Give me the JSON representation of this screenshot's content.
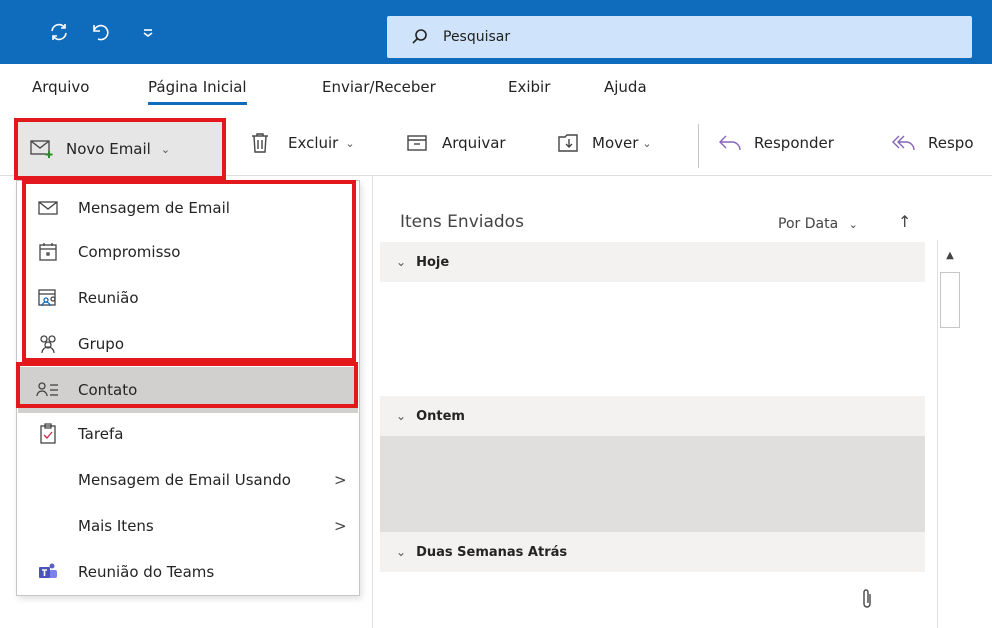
{
  "titlebar": {
    "search_placeholder": "Pesquisar",
    "sync_icon": "sync-icon",
    "undo_icon": "undo-icon",
    "quick_access_icon": "customize-icon"
  },
  "menu": {
    "tabs": [
      {
        "label": "Arquivo"
      },
      {
        "label": "Página Inicial"
      },
      {
        "label": "Enviar/Receber"
      },
      {
        "label": "Exibir"
      },
      {
        "label": "Ajuda"
      }
    ]
  },
  "ribbon": {
    "new_email": "Novo Email",
    "delete": "Excluir",
    "archive": "Arquivar",
    "move": "Mover",
    "reply": "Responder",
    "reply_all": "Respo"
  },
  "dropdown": {
    "items": [
      {
        "label": "Mensagem de Email",
        "icon": "mail-icon"
      },
      {
        "label": "Compromisso",
        "icon": "calendar-icon"
      },
      {
        "label": "Reunião",
        "icon": "meeting-icon"
      },
      {
        "label": "Grupo",
        "icon": "group-icon"
      },
      {
        "label": "Contato",
        "icon": "contact-icon"
      },
      {
        "label": "Tarefa",
        "icon": "task-icon"
      },
      {
        "label": "Mensagem de Email Usando"
      },
      {
        "label": "Mais Itens"
      },
      {
        "label": "Reunião do Teams",
        "icon": "teams-icon"
      }
    ],
    "submenu_arrow": ">"
  },
  "maillist": {
    "folder_title": "Itens Enviados",
    "sort_label": "Por Data",
    "sort_direction": "↑",
    "groups": [
      {
        "label": "Hoje"
      },
      {
        "label": "Ontem"
      },
      {
        "label": "Duas Semanas Atrás"
      }
    ]
  },
  "colors": {
    "titlebar": "#0f6cbd",
    "search_bg": "#cfe4fa",
    "highlight_red": "#e3181d"
  }
}
